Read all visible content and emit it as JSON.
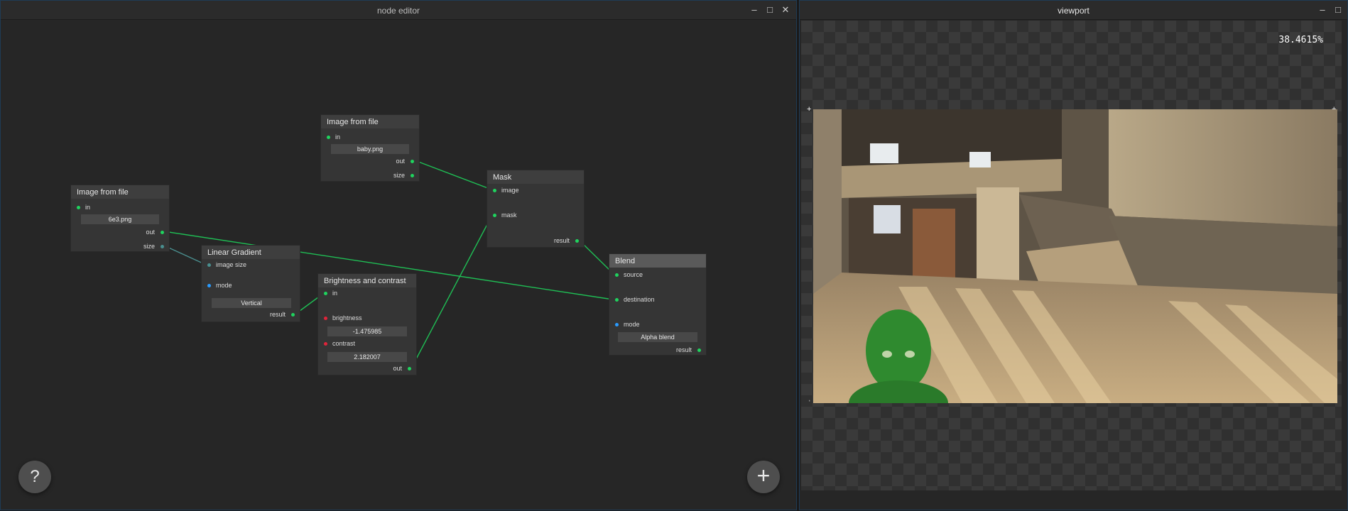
{
  "node_editor": {
    "title": "node editor",
    "controls": {
      "minimize": "‒",
      "maximize": "□",
      "close": "✕"
    },
    "help_label": "?",
    "add_label": "+",
    "nodes": {
      "image_file_1": {
        "title": "Image from file",
        "in": "in",
        "filename": "6e3.png",
        "out": "out",
        "size": "size"
      },
      "image_file_2": {
        "title": "Image from file",
        "in": "in",
        "filename": "baby.png",
        "out": "out",
        "size": "size"
      },
      "linear_gradient": {
        "title": "Linear Gradient",
        "image_size": "image size",
        "mode": "mode",
        "mode_value": "Vertical",
        "result": "result"
      },
      "brightness_contrast": {
        "title": "Brightness and contrast",
        "in": "in",
        "brightness": "brightness",
        "brightness_value": "-1.475985",
        "contrast": "contrast",
        "contrast_value": "2.182007",
        "out": "out"
      },
      "mask": {
        "title": "Mask",
        "image": "image",
        "mask": "mask",
        "result": "result"
      },
      "blend": {
        "title": "Blend",
        "source": "source",
        "destination": "destination",
        "mode": "mode",
        "mode_value": "Alpha blend",
        "result": "result"
      }
    }
  },
  "viewport": {
    "title": "viewport",
    "controls": {
      "minimize": "‒",
      "maximize": "□"
    },
    "zoom": "38.4615%"
  },
  "colors": {
    "wire": "#1fbf55",
    "wire_dim": "#4a8f8f",
    "port_green": "#1fd35e",
    "port_blue": "#2a9bff",
    "port_red": "#e0243a",
    "window_border": "#1f3b55"
  }
}
